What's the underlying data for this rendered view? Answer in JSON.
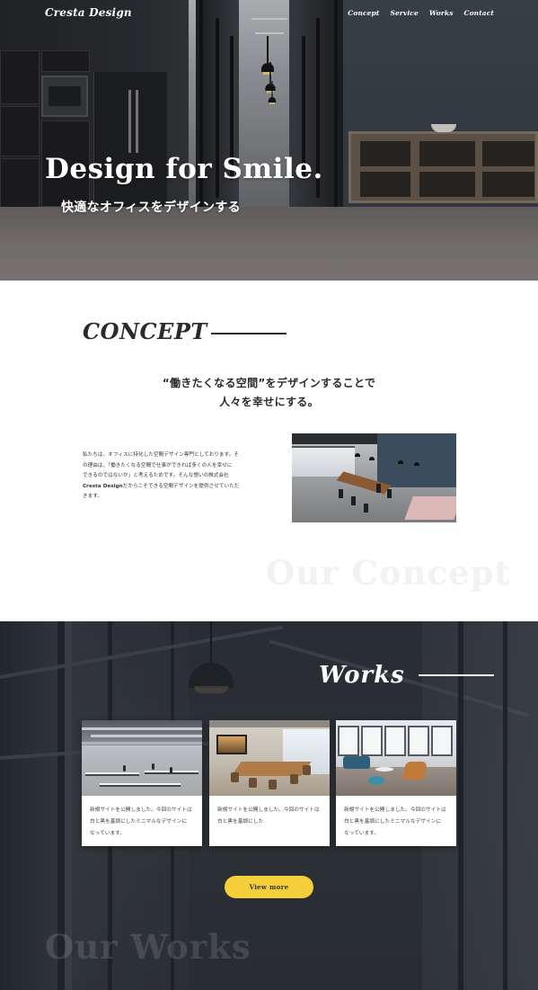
{
  "header": {
    "brand": "Cresta Design",
    "nav": [
      "Concept",
      "Service",
      "Works",
      "Contact"
    ]
  },
  "hero": {
    "title": "Design for Smile.",
    "subtitle": "快適なオフィスをデザインする"
  },
  "concept": {
    "heading": "CONCEPT",
    "lead": [
      "“働きたくなる空間”をデザインすることで",
      "人々を幸せにする。"
    ],
    "body": [
      "私たちは、オフィスに特化した空間デザイン専門としております。そ",
      "の理由は、「働きたくなる空間で仕事ができれば多くの人を幸せに",
      "できるのではないか」と考えるためです。そんな想いの株式会社",
      "Cresta Designだからこそできる空間デザインを提供させていただ",
      "きます。"
    ],
    "body_strong_prefix": "Cresta Design",
    "ghost": "Our Concept"
  },
  "works": {
    "heading": "Works",
    "cards": [
      {
        "lines": [
          "新規サイトを公開しました。今回のサイトは",
          "白と黒を基調にしたミニマルなデザインに",
          "なっています。"
        ]
      },
      {
        "lines": [
          "新規サイトを公開しました。今回のサイトは",
          "白と黒を基調にした"
        ]
      },
      {
        "lines": [
          "新規サイトを公開しました。今回のサイトは",
          "白と黒を基調にしたミニマルなデザインに",
          "なっています。"
        ]
      }
    ],
    "button": "View more",
    "ghost": "Our Works"
  },
  "colors": {
    "accent_button": "#f5cf3a",
    "dark_text": "#2b2b2b",
    "works_bg": "#2e3238"
  }
}
